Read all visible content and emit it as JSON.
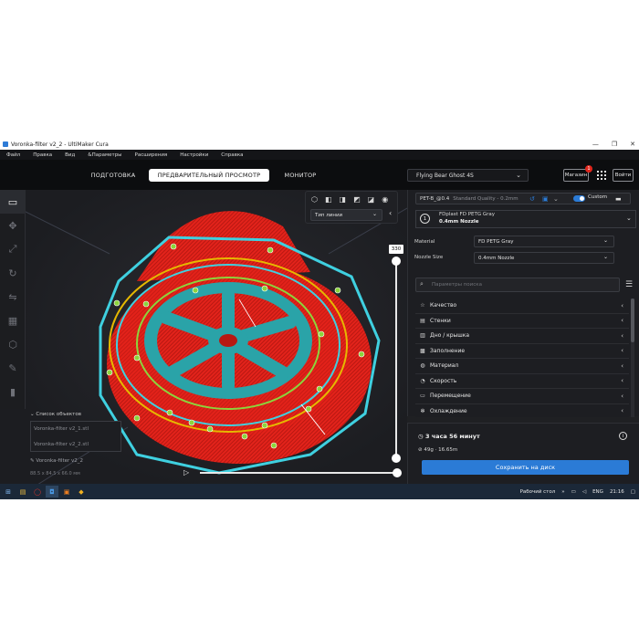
{
  "window": {
    "title": "Voronka-filter v2_2 - UltiMaker Cura",
    "controls": [
      "—",
      "❐",
      "✕"
    ]
  },
  "menu": {
    "items": [
      "Файл",
      "Правка",
      "Вид",
      "&Параметры",
      "Расширения",
      "Настройки",
      "Справка"
    ]
  },
  "stages": {
    "prepare": "ПОДГОТОВКА",
    "preview": "ПРЕДВАРИТЕЛЬНЫЙ ПРОСМОТР",
    "monitor": "МОНИТОР"
  },
  "printer": {
    "name": "Flying Bear Ghost 4S"
  },
  "header": {
    "marketplace": "Магазин",
    "marketplace_badge": "1",
    "login": "Войти"
  },
  "view": {
    "line_type": "Тип линии",
    "layer_number": "330"
  },
  "objects": {
    "header": "Список объектов",
    "items": [
      "Voronka-filter v2_1.stl",
      "Voronka-filter v2_2.stl"
    ],
    "current": "Voronka-filter v2_2",
    "dimensions": "88.5 x 84.5 x 66.0 мм"
  },
  "print_settings": {
    "profile": "PET-B_@0.4",
    "quality": "Standard Quality - 0.2mm",
    "custom_label": "Custom",
    "extruder_index": "1",
    "extruder_material": "FDplast FD PETG Gray",
    "extruder_nozzle": "0.4mm Nozzle",
    "material_label": "Material",
    "material_value": "FD PETG Gray",
    "nozzle_label": "Nozzle Size",
    "nozzle_value": "0.4mm Nozzle",
    "search_placeholder": "Параметры поиска",
    "categories": [
      {
        "label": "Качество",
        "icon": "star-icon"
      },
      {
        "label": "Стенки",
        "icon": "walls-icon"
      },
      {
        "label": "Дно / крышка",
        "icon": "top-bottom-icon"
      },
      {
        "label": "Заполнение",
        "icon": "infill-icon"
      },
      {
        "label": "Материал",
        "icon": "material-icon"
      },
      {
        "label": "Скорость",
        "icon": "speed-icon"
      },
      {
        "label": "Перемещение",
        "icon": "travel-icon"
      },
      {
        "label": "Охлаждение",
        "icon": "cooling-icon"
      }
    ]
  },
  "summary": {
    "time": "3 часа 56 минут",
    "material": "49g · 16.65m",
    "save_button": "Сохранить на диск"
  },
  "taskbar": {
    "desktop": "Рабочий стол",
    "lang": "ENG",
    "clock": "21:16"
  },
  "colors": {
    "accent": "#2b7bd6",
    "model_red": "#e3231b",
    "model_teal": "#2aa3a8",
    "support_green": "#8cd43c"
  }
}
